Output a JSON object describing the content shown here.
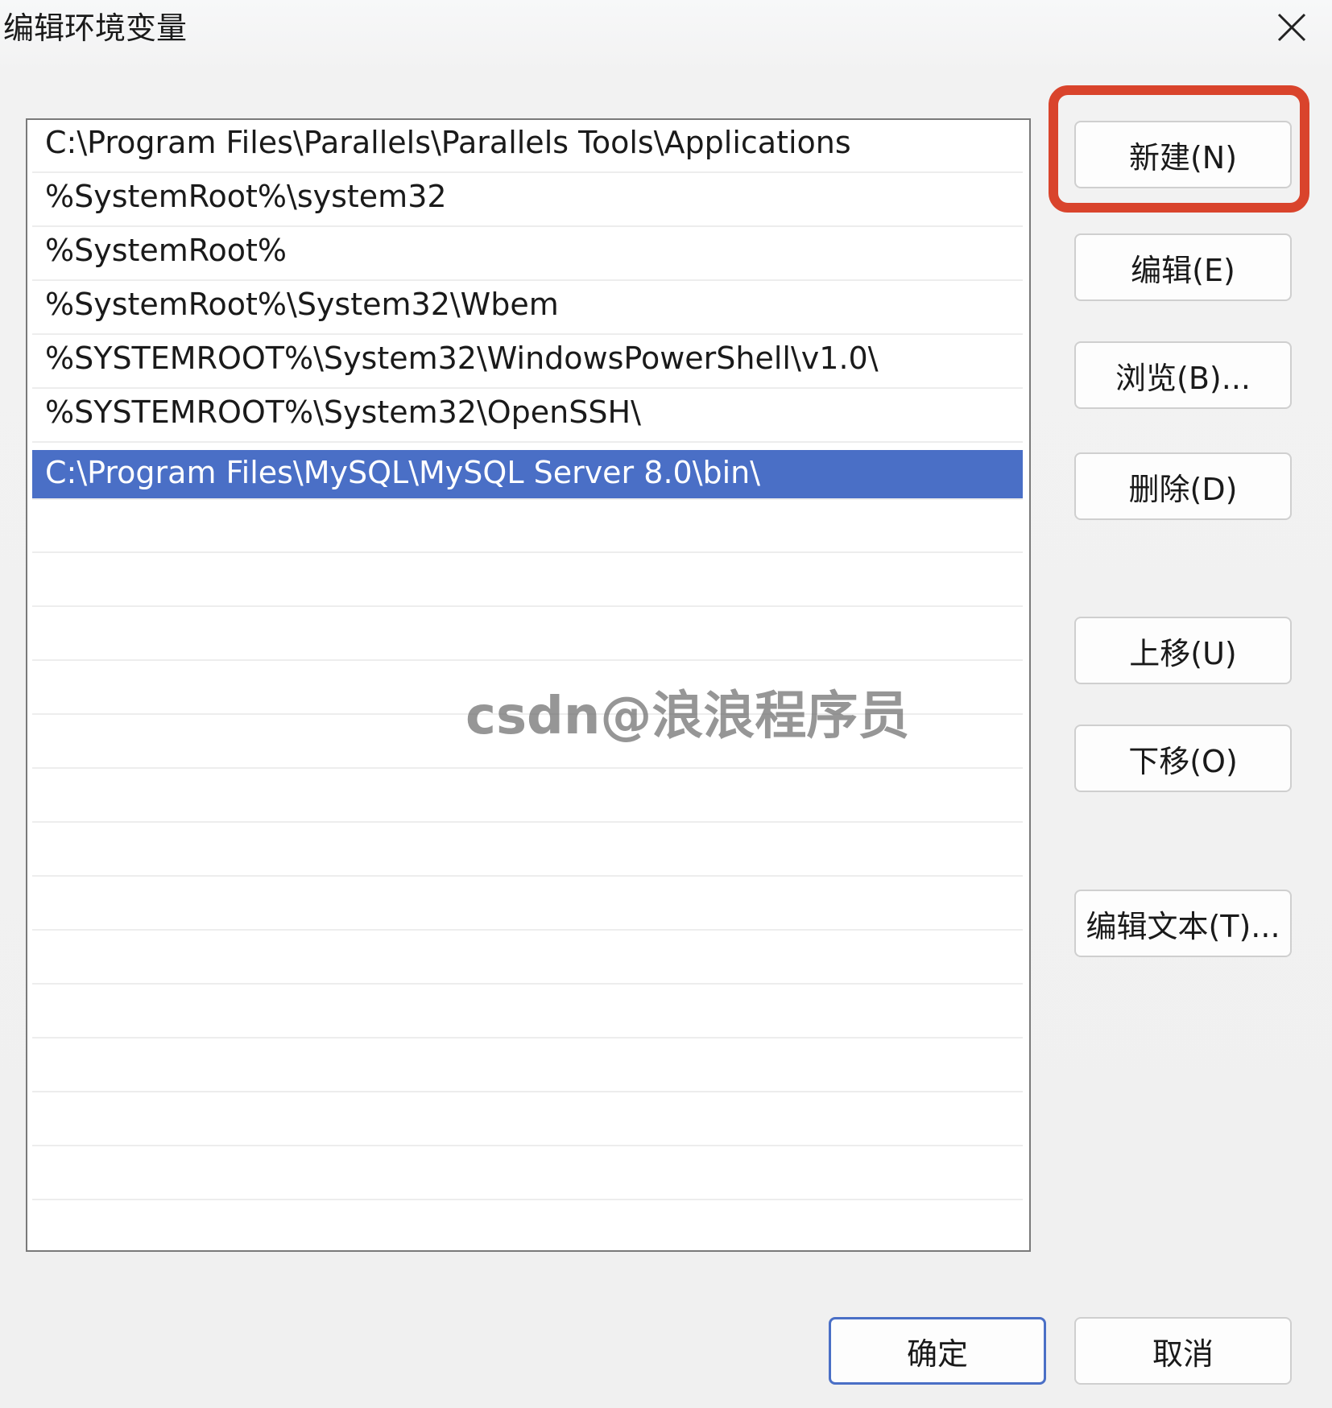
{
  "window": {
    "title": "编辑环境变量"
  },
  "path_list": [
    "C:\\Program Files\\Parallels\\Parallels Tools\\Applications",
    "%SystemRoot%\\system32",
    "%SystemRoot%",
    "%SystemRoot%\\System32\\Wbem",
    "%SYSTEMROOT%\\System32\\WindowsPowerShell\\v1.0\\",
    "%SYSTEMROOT%\\System32\\OpenSSH\\",
    "C:\\Program Files\\MySQL\\MySQL Server 8.0\\bin\\"
  ],
  "selected_index": 6,
  "watermark": "csdn@浪浪程序员",
  "buttons": {
    "new": "新建(N)",
    "edit": "编辑(E)",
    "browse": "浏览(B)...",
    "delete": "删除(D)",
    "move_up": "上移(U)",
    "move_down": "下移(O)",
    "edit_text": "编辑文本(T)...",
    "ok": "确定",
    "cancel": "取消"
  },
  "colors": {
    "selection": "#4a6fc6",
    "highlight_box": "#d9442c"
  },
  "icons": {
    "close": "close-icon"
  }
}
